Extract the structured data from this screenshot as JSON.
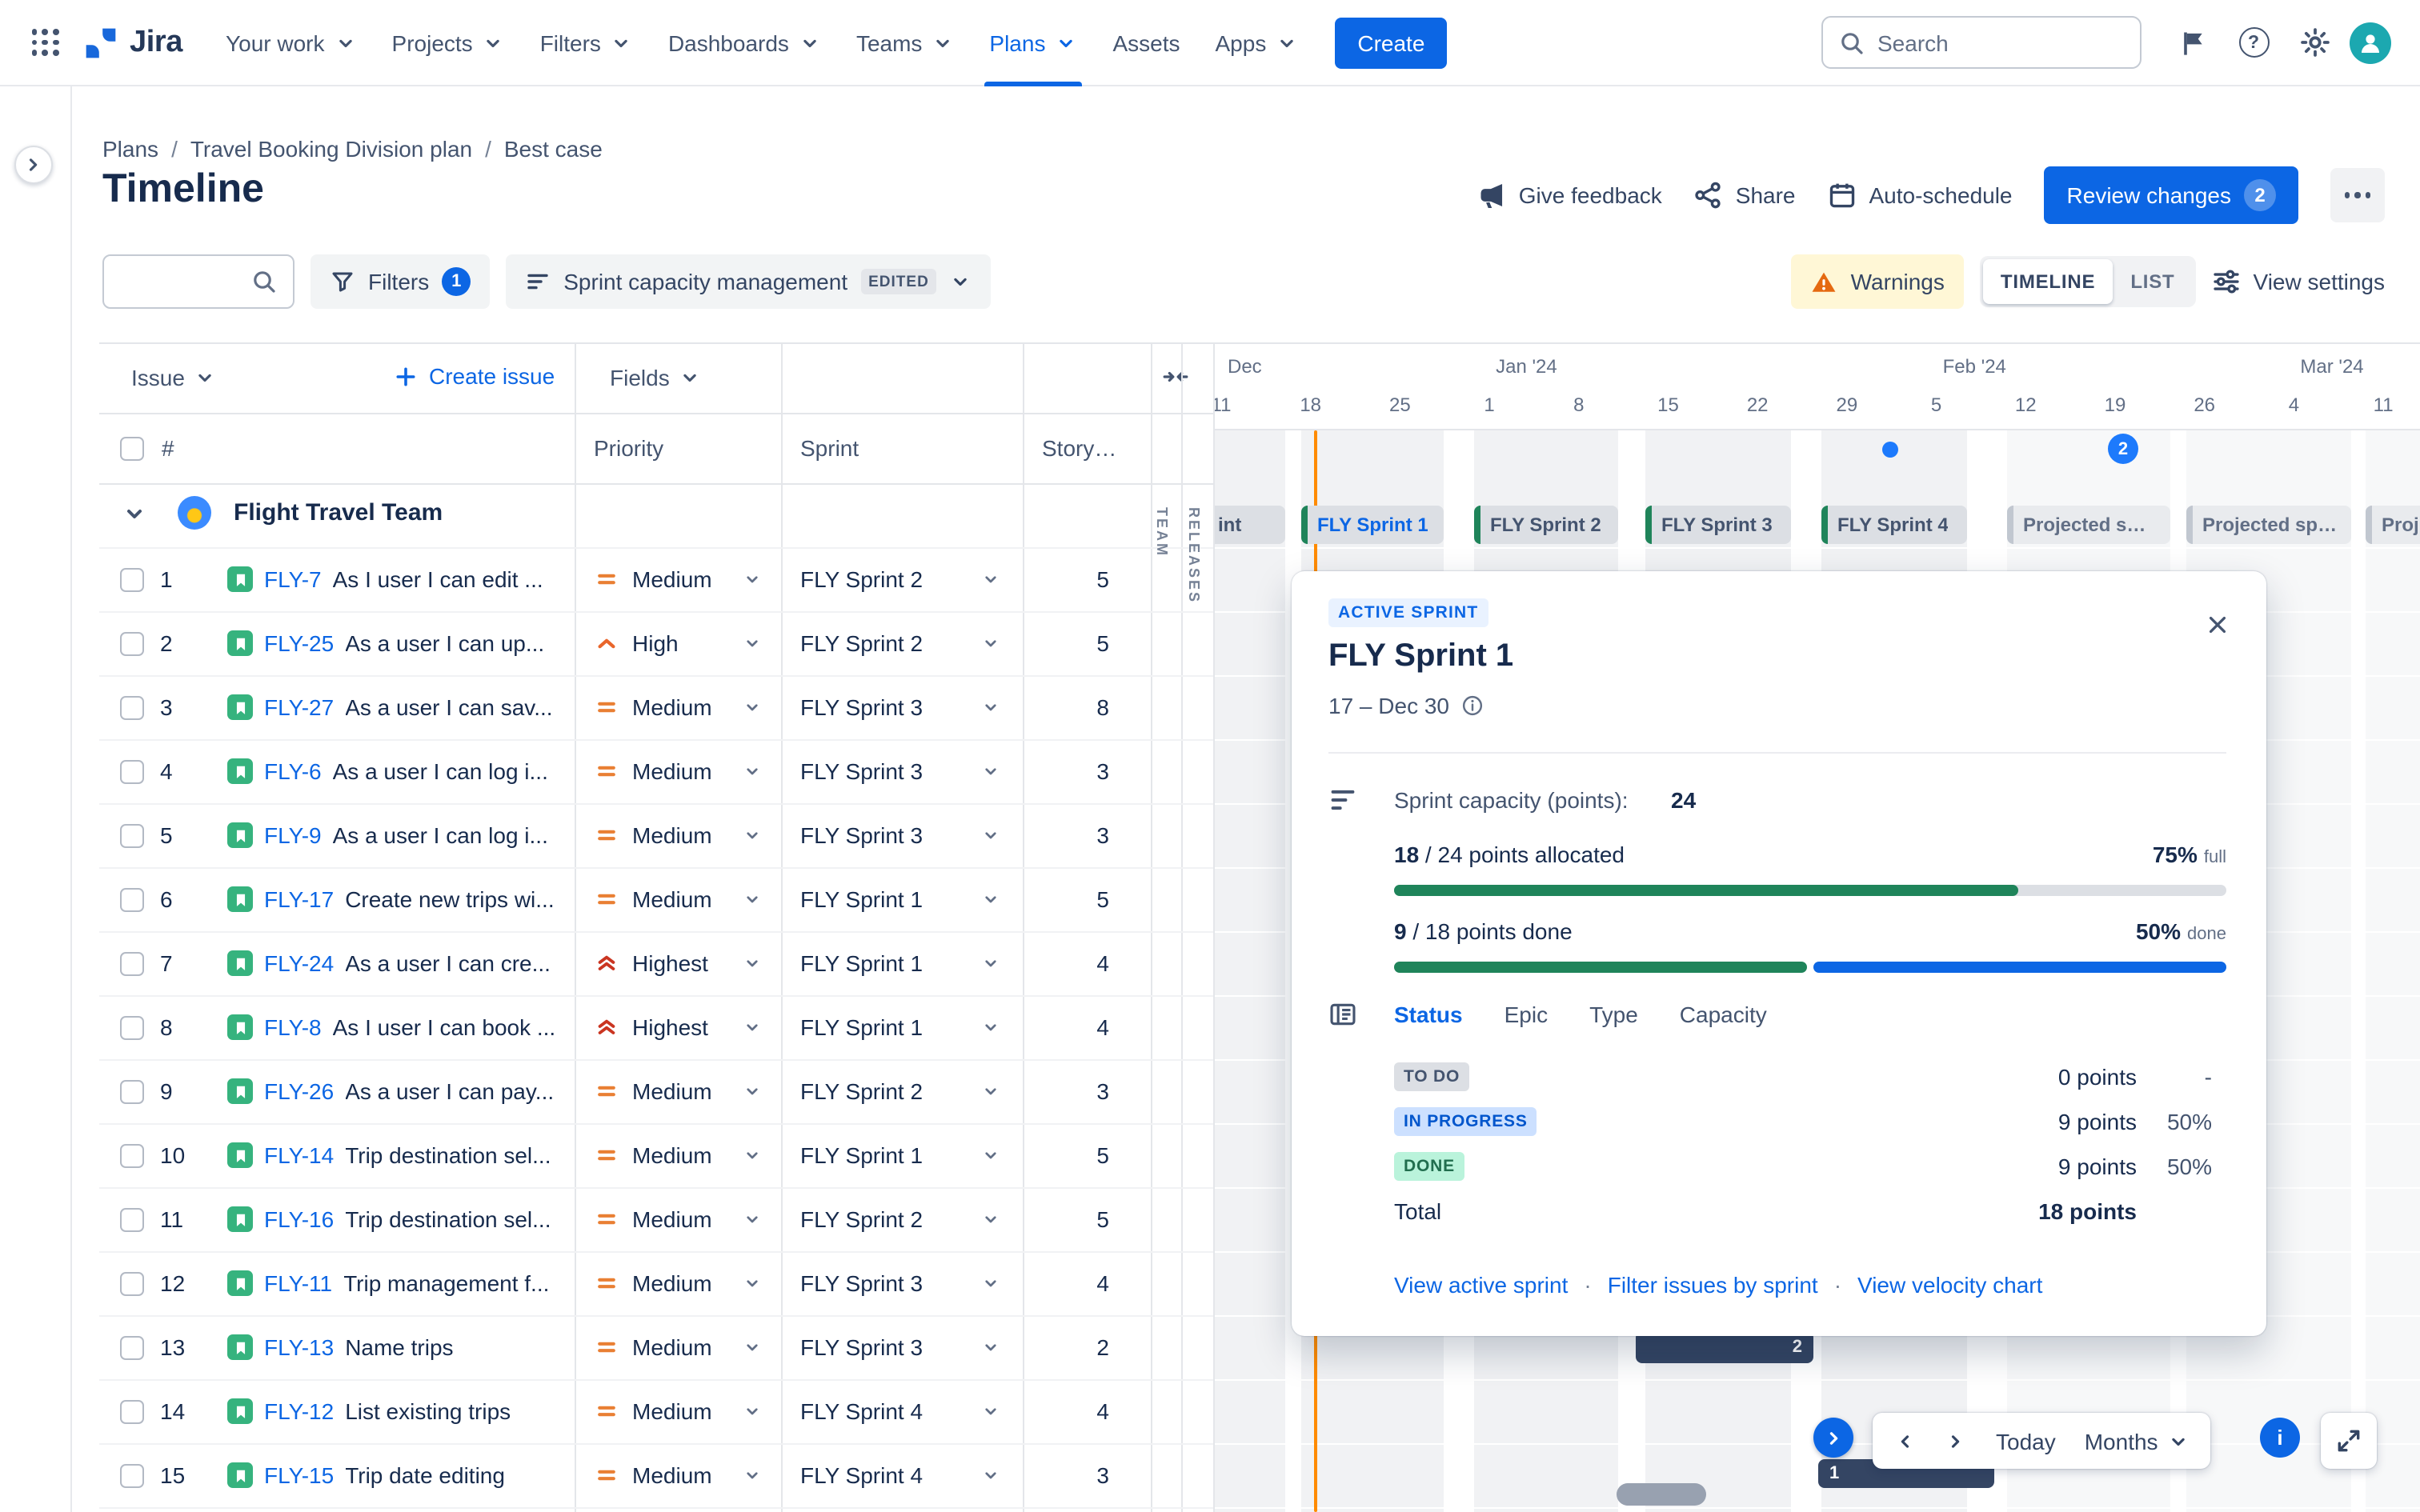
{
  "nav": {
    "logo_text": "Jira",
    "search_placeholder": "Search",
    "create_label": "Create",
    "menu": [
      {
        "label": "Your work",
        "chevron": true
      },
      {
        "label": "Projects",
        "chevron": true
      },
      {
        "label": "Filters",
        "chevron": true
      },
      {
        "label": "Dashboards",
        "chevron": true
      },
      {
        "label": "Teams",
        "chevron": true
      },
      {
        "label": "Plans",
        "chevron": true,
        "active": true
      },
      {
        "label": "Assets",
        "chevron": false
      },
      {
        "label": "Apps",
        "chevron": true
      }
    ]
  },
  "breadcrumb": {
    "items": [
      "Plans",
      "Travel Booking Division plan",
      "Best case"
    ],
    "separator": "/"
  },
  "page": {
    "title": "Timeline"
  },
  "actions": {
    "give_feedback": "Give feedback",
    "share": "Share",
    "auto_schedule": "Auto-schedule",
    "review_changes": "Review changes",
    "review_count": "2"
  },
  "toolbar": {
    "filters_label": "Filters",
    "filters_count": "1",
    "view_config": "Sprint capacity management",
    "edited_badge": "EDITED",
    "warnings_label": "Warnings",
    "timeline_toggle": "TIMELINE",
    "list_toggle": "LIST",
    "view_settings": "View settings"
  },
  "table": {
    "issue_label": "Issue",
    "create_issue": "Create issue",
    "fields_label": "Fields",
    "columns": {
      "num": "#",
      "priority": "Priority",
      "sprint": "Sprint",
      "points": "Story…"
    },
    "group_name": "Flight Travel Team",
    "rows": [
      {
        "num": "1",
        "key": "FLY-7",
        "summary": "As I user I can edit ...",
        "priority": "Medium",
        "sprint": "FLY Sprint 2",
        "points": "5"
      },
      {
        "num": "2",
        "key": "FLY-25",
        "summary": "As a user I can up...",
        "priority": "High",
        "sprint": "FLY Sprint 2",
        "points": "5"
      },
      {
        "num": "3",
        "key": "FLY-27",
        "summary": "As a user I can sav...",
        "priority": "Medium",
        "sprint": "FLY Sprint 3",
        "points": "8"
      },
      {
        "num": "4",
        "key": "FLY-6",
        "summary": "As a user I can log i...",
        "priority": "Medium",
        "sprint": "FLY Sprint 3",
        "points": "3"
      },
      {
        "num": "5",
        "key": "FLY-9",
        "summary": "As a user I can log i...",
        "priority": "Medium",
        "sprint": "FLY Sprint 3",
        "points": "3"
      },
      {
        "num": "6",
        "key": "FLY-17",
        "summary": "Create new trips wi...",
        "priority": "Medium",
        "sprint": "FLY Sprint 1",
        "points": "5"
      },
      {
        "num": "7",
        "key": "FLY-24",
        "summary": "As a user I can cre...",
        "priority": "Highest",
        "sprint": "FLY Sprint 1",
        "points": "4"
      },
      {
        "num": "8",
        "key": "FLY-8",
        "summary": "As I user I can book ...",
        "priority": "Highest",
        "sprint": "FLY Sprint 1",
        "points": "4"
      },
      {
        "num": "9",
        "key": "FLY-26",
        "summary": "As a user I can pay...",
        "priority": "Medium",
        "sprint": "FLY Sprint 2",
        "points": "3"
      },
      {
        "num": "10",
        "key": "FLY-14",
        "summary": "Trip destination sel...",
        "priority": "Medium",
        "sprint": "FLY Sprint 1",
        "points": "5"
      },
      {
        "num": "11",
        "key": "FLY-16",
        "summary": "Trip destination sel...",
        "priority": "Medium",
        "sprint": "FLY Sprint 2",
        "points": "5"
      },
      {
        "num": "12",
        "key": "FLY-11",
        "summary": "Trip management f...",
        "priority": "Medium",
        "sprint": "FLY Sprint 3",
        "points": "4"
      },
      {
        "num": "13",
        "key": "FLY-13",
        "summary": "Name trips",
        "priority": "Medium",
        "sprint": "FLY Sprint 3",
        "points": "2"
      },
      {
        "num": "14",
        "key": "FLY-12",
        "summary": "List existing trips",
        "priority": "Medium",
        "sprint": "FLY Sprint 4",
        "points": "4"
      },
      {
        "num": "15",
        "key": "FLY-15",
        "summary": "Trip date editing",
        "priority": "Medium",
        "sprint": "FLY Sprint 4",
        "points": "3"
      }
    ]
  },
  "timeline": {
    "months": [
      {
        "label": "Dec",
        "ticks": [
          "11",
          "18",
          "25"
        ]
      },
      {
        "label": "Jan '24",
        "ticks": [
          "1",
          "8",
          "15",
          "22",
          "29"
        ]
      },
      {
        "label": "Feb '24",
        "ticks": [
          "5",
          "12",
          "19",
          "26"
        ]
      },
      {
        "label": "Mar '24",
        "ticks": [
          "4",
          "11"
        ]
      }
    ],
    "side_labels": {
      "team": "TEAM",
      "releases": "RELEASES"
    },
    "sprints": [
      "int",
      "FLY Sprint 1",
      "FLY Sprint 2",
      "FLY Sprint 3",
      "FLY Sprint 4",
      "Projected spr...",
      "Projected spr...",
      "Proj..."
    ],
    "milestone_count": "2",
    "bar_counts": [
      "2",
      "1"
    ]
  },
  "popup": {
    "badge": "ACTIVE SPRINT",
    "title": "FLY Sprint 1",
    "dates": "17 – Dec 30",
    "capacity_label": "Sprint capacity (points):",
    "capacity_value": "24",
    "allocated": {
      "bold": "18",
      "rest": " / 24 points allocated",
      "pct": "75%",
      "suffix": "full"
    },
    "done": {
      "bold": "9",
      "rest": " / 18 points done",
      "pct": "50%",
      "suffix": "done"
    },
    "tabs": [
      {
        "label": "Status",
        "active": true
      },
      {
        "label": "Epic"
      },
      {
        "label": "Type"
      },
      {
        "label": "Capacity"
      }
    ],
    "status_rows": [
      {
        "label": "TO DO",
        "kind": "todo",
        "points": "0 points",
        "pct": "-"
      },
      {
        "label": "IN PROGRESS",
        "kind": "inprogress",
        "points": "9 points",
        "pct": "50%"
      },
      {
        "label": "DONE",
        "kind": "done",
        "points": "9 points",
        "pct": "50%"
      }
    ],
    "total_label": "Total",
    "total_value": "18 points",
    "links": [
      "View active sprint",
      "Filter issues by sprint",
      "View velocity chart"
    ],
    "link_separator": "·"
  },
  "controls": {
    "today": "Today",
    "range": "Months"
  }
}
